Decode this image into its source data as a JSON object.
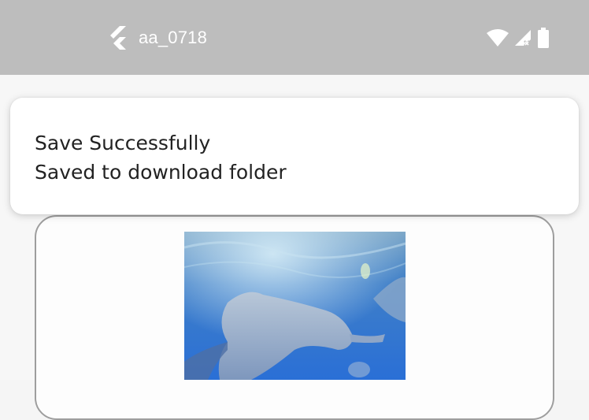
{
  "status_bar": {
    "app_title": "aa_0718",
    "icons": [
      "flutter-logo-icon",
      "wifi-icon",
      "cellular-no-signal-icon",
      "battery-icon"
    ],
    "background_color": "#bdbdbd"
  },
  "toast": {
    "title": "Save Successfully",
    "message": "Saved to download folder"
  },
  "image_card": {
    "image_subject": "stingray-underwater-photo"
  },
  "colors": {
    "toast_bg": "#ffffff",
    "page_bg": "#f7f7f7",
    "card_border": "#9e9e9e",
    "water_blue": "#3b7fd6"
  }
}
